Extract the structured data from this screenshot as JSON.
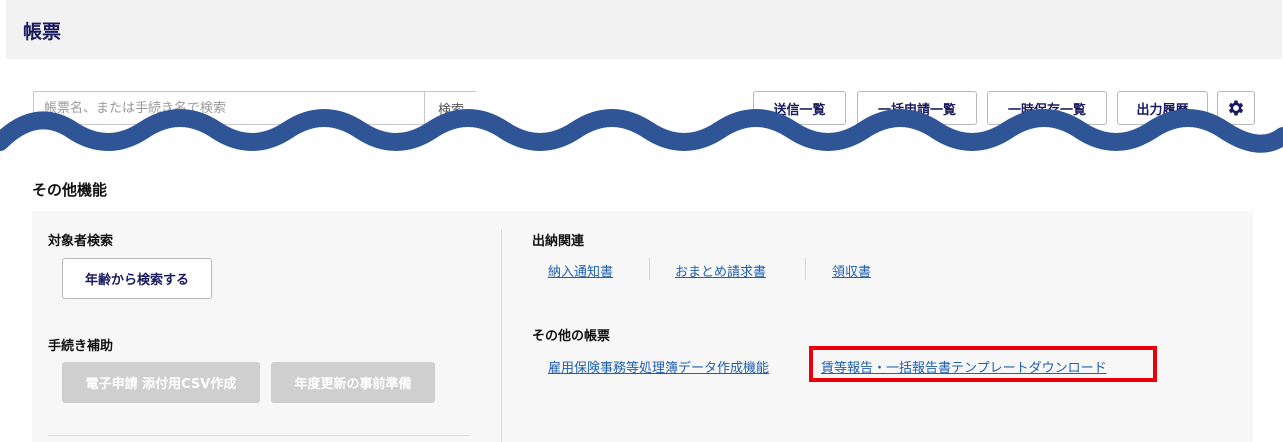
{
  "header": {
    "title": "帳票"
  },
  "search": {
    "placeholder": "帳票名、または手続き名で検索",
    "button_label": "検索"
  },
  "toolbar": {
    "sent_list": "送信一覧",
    "bulk_application_list": "一括申請一覧",
    "temp_saved_list": "一時保存一覧",
    "output_history": "出力履歴"
  },
  "other_functions": {
    "title": "その他機能",
    "target_search": {
      "title": "対象者検索",
      "age_search_button": "年齢から検索する"
    },
    "procedure_assist": {
      "title": "手続き補助",
      "csv_button": "電子申請 添付用CSV作成",
      "annual_update_button": "年度更新の事前準備"
    },
    "disbursement": {
      "title": "出納関連",
      "links": [
        "納入通知書",
        "おまとめ請求書",
        "領収書"
      ]
    },
    "other_forms": {
      "title": "その他の帳票",
      "links": [
        "雇用保険事務等処理簿データ作成機能",
        "賃等報告・一括報告書テンプレートダウンロード"
      ]
    }
  },
  "colors": {
    "accent_text": "#1a1a5e",
    "link": "#1f5fb0",
    "wave": "#2f5597",
    "highlight": "#e8000b"
  }
}
